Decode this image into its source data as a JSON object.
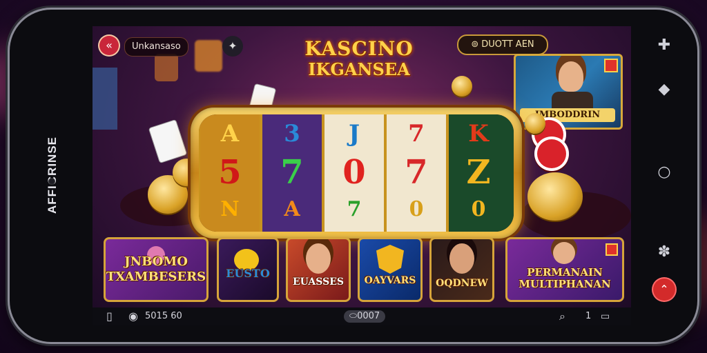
{
  "device": {
    "side_label": "AFFICRINSE"
  },
  "header": {
    "player_name": "Unkansaso",
    "title_line1": "KASCINO",
    "title_line2": "IKGANSEA",
    "balance_label": "DUOTT AEN",
    "promo_label": "IMBODDRIN"
  },
  "slot": {
    "reels": [
      {
        "top": "A",
        "mid": "5",
        "bot": "N",
        "bg": "#c98a1e",
        "color": "#ffb000"
      },
      {
        "top": "3",
        "mid": "7",
        "bot": "A",
        "bg": "#4a2a7a",
        "color": "#3ad04a"
      },
      {
        "top": "J",
        "mid": "0",
        "bot": "7",
        "bg": "#f1e7cf",
        "color": "#e0231f"
      },
      {
        "top": "7",
        "mid": "7",
        "bot": "0",
        "bg": "#f1e7cf",
        "color": "#d8282a"
      },
      {
        "top": "K",
        "mid": "Z",
        "bot": "0",
        "bg": "#1a4a2a",
        "color": "#f2b620"
      }
    ]
  },
  "games": [
    {
      "label": "JNBOMO TXAMBESERS"
    },
    {
      "label": "EUSTO"
    },
    {
      "label": "EUASSES"
    },
    {
      "label": "OAYVARS"
    },
    {
      "label": "OQDNEW"
    },
    {
      "label": "PERMANAIN MULTIPHANAN"
    }
  ],
  "status_bar": {
    "left_value": "5015 60",
    "center_value": "0007",
    "right_value": "1"
  },
  "colors": {
    "accent_gold": "#d6a43a",
    "red_button": "#d32a2a"
  }
}
